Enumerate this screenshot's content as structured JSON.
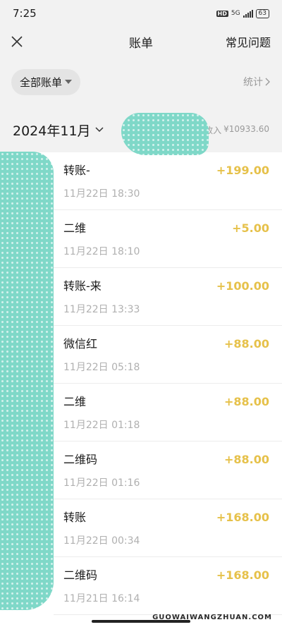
{
  "status_bar": {
    "time": "7:25",
    "hd": "HD",
    "network": "5G",
    "battery": "63"
  },
  "nav": {
    "title": "账单",
    "faq_label": "常见问题"
  },
  "filter": {
    "label": "全部账单",
    "stats_label": "统计"
  },
  "month": {
    "label": "2024年11月",
    "income_label": "收入",
    "income_value": "¥10933.60"
  },
  "transactions": [
    {
      "title": "转账-",
      "time": "11月22日 18:30",
      "amount": "+199.00"
    },
    {
      "title": "二维",
      "time": "11月22日 18:10",
      "amount": "+5.00"
    },
    {
      "title": "转账-来",
      "time": "11月22日 13:33",
      "amount": "+100.00"
    },
    {
      "title": "微信红",
      "time": "11月22日 05:18",
      "amount": "+88.00"
    },
    {
      "title": "二维",
      "time": "11月22日 01:18",
      "amount": "+88.00"
    },
    {
      "title": "二维码",
      "time": "11月22日 01:16",
      "amount": "+88.00"
    },
    {
      "title": "转账",
      "time": "11月22日 00:34",
      "amount": "+168.00"
    },
    {
      "title": "二维码",
      "time": "11月21日 16:14",
      "amount": "+168.00"
    }
  ],
  "watermark": "GUOWAIWANGZHUAN.COM",
  "colors": {
    "amount": "#e6c14a",
    "background": "#f2f2f2",
    "scribble": "#7fd8c8"
  }
}
